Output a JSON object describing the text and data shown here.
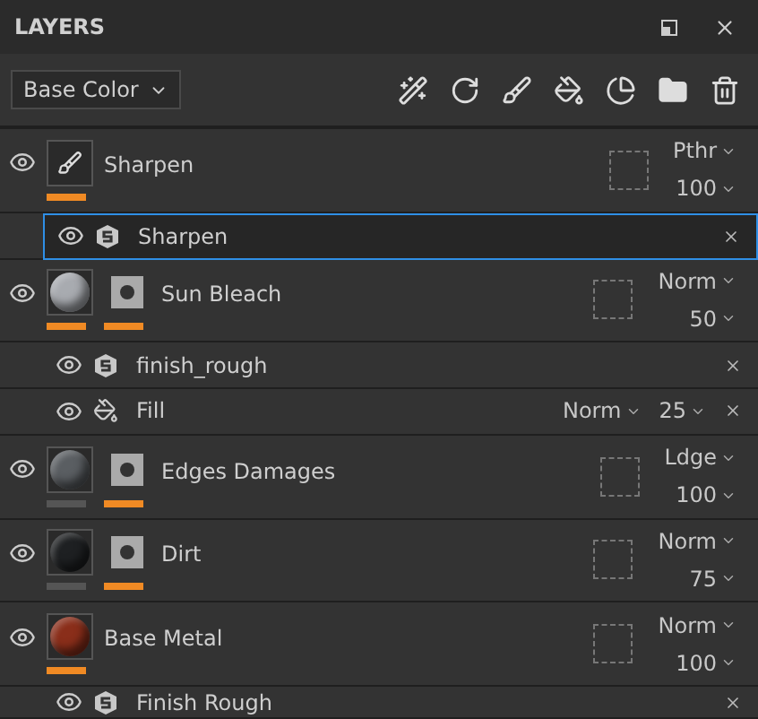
{
  "panel": {
    "title": "LAYERS"
  },
  "channel_select": {
    "value": "Base Color"
  },
  "layers": [
    {
      "kind": "layer",
      "name": "Sharpen",
      "selected": false,
      "thumbnail": {
        "kind": "brush",
        "active": true
      },
      "blend": "Pthr",
      "opacity": "100"
    },
    {
      "kind": "filter",
      "name": "Sharpen",
      "selected": true
    },
    {
      "kind": "layer",
      "name": "Sun Bleach",
      "selected": false,
      "thumbnail": {
        "kind": "sphere",
        "color": "#a8abb0",
        "active": true
      },
      "mask": {
        "active": true
      },
      "blend": "Norm",
      "opacity": "50"
    },
    {
      "kind": "filter",
      "name": "finish_rough",
      "selected": false
    },
    {
      "kind": "fill",
      "name": "Fill",
      "selected": false,
      "blend": "Norm",
      "opacity": "25"
    },
    {
      "kind": "layer",
      "name": "Edges Damages",
      "selected": false,
      "thumbnail": {
        "kind": "sphere",
        "color": "#5a5e62",
        "active": false
      },
      "mask": {
        "active": true
      },
      "blend": "Ldge",
      "opacity": "100"
    },
    {
      "kind": "layer",
      "name": "Dirt",
      "selected": false,
      "thumbnail": {
        "kind": "sphere",
        "color": "#1e2022",
        "active": false
      },
      "mask": {
        "active": true
      },
      "blend": "Norm",
      "opacity": "75"
    },
    {
      "kind": "layer",
      "name": "Base Metal",
      "selected": false,
      "thumbnail": {
        "kind": "sphere",
        "color": "#8a2e1a",
        "active": true
      },
      "blend": "Norm",
      "opacity": "100"
    },
    {
      "kind": "filter",
      "name": "Finish Rough",
      "selected": false
    }
  ]
}
